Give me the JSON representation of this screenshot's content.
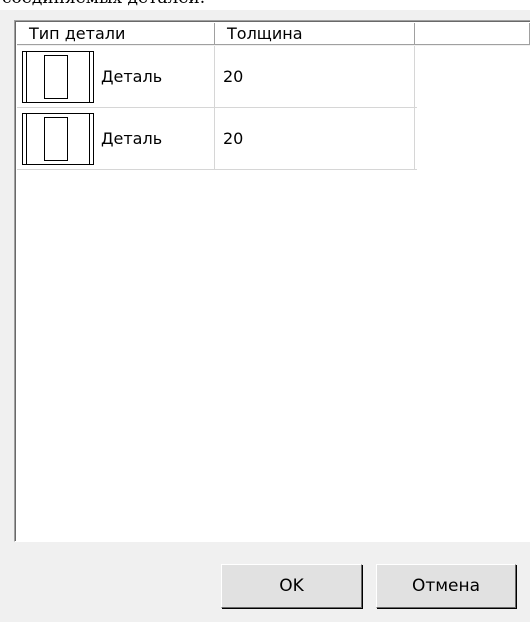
{
  "window": {
    "top_text": "соединяемых деталей."
  },
  "list": {
    "columns": [
      {
        "label": "Тип детали"
      },
      {
        "label": "Толщина"
      },
      {
        "label": ""
      }
    ],
    "rows": [
      {
        "icon": "part-panel-icon",
        "type": "Деталь",
        "thickness": "20"
      },
      {
        "icon": "part-panel-icon",
        "type": "Деталь",
        "thickness": "20"
      }
    ]
  },
  "buttons": {
    "ok_label": "OK",
    "cancel_label": "Отмена"
  }
}
